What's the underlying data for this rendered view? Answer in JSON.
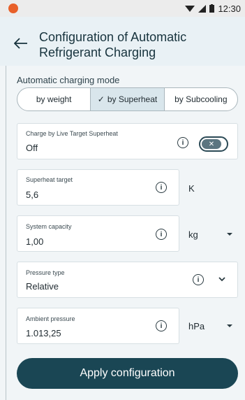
{
  "status_bar": {
    "time": "12:30"
  },
  "header": {
    "title": "Configuration of Automatic Refrigerant Charging"
  },
  "mode": {
    "section_label": "Automatic charging mode",
    "options": [
      "by weight",
      "by Superheat",
      "by Subcooling"
    ],
    "selected": "by Superheat"
  },
  "live_target": {
    "label": "Charge by Live Target Superheat",
    "value": "Off"
  },
  "superheat_target": {
    "label": "Superheat target",
    "value": "5,6",
    "unit": "K"
  },
  "system_capacity": {
    "label": "System capacity",
    "value": "1,00",
    "unit": "kg"
  },
  "pressure_type": {
    "label": "Pressure type",
    "value": "Relative"
  },
  "ambient_pressure": {
    "label": "Ambient pressure",
    "value": "1.013,25",
    "unit": "hPa"
  },
  "apply_label": "Apply configuration",
  "colors": {
    "primary": "#1a4654",
    "app_bar": "#e9f1f5",
    "segment_selected": "#d9e6ec",
    "status_logo": "#e8602a"
  }
}
